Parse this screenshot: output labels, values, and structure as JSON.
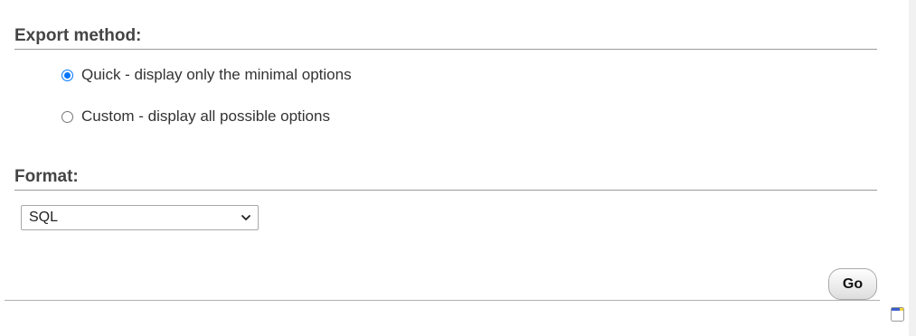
{
  "export_method": {
    "title": "Export method:",
    "options": [
      {
        "label": "Quick - display only the minimal options",
        "selected": true
      },
      {
        "label": "Custom - display all possible options",
        "selected": false
      }
    ]
  },
  "format": {
    "title": "Format:",
    "selected": "SQL"
  },
  "actions": {
    "go_label": "Go"
  },
  "colors": {
    "radio_accent": "#0075ff",
    "title_text": "#444444",
    "body_text": "#333333"
  },
  "icons": {
    "dropdown": "chevron-down-icon",
    "corner": "notes-icon"
  }
}
